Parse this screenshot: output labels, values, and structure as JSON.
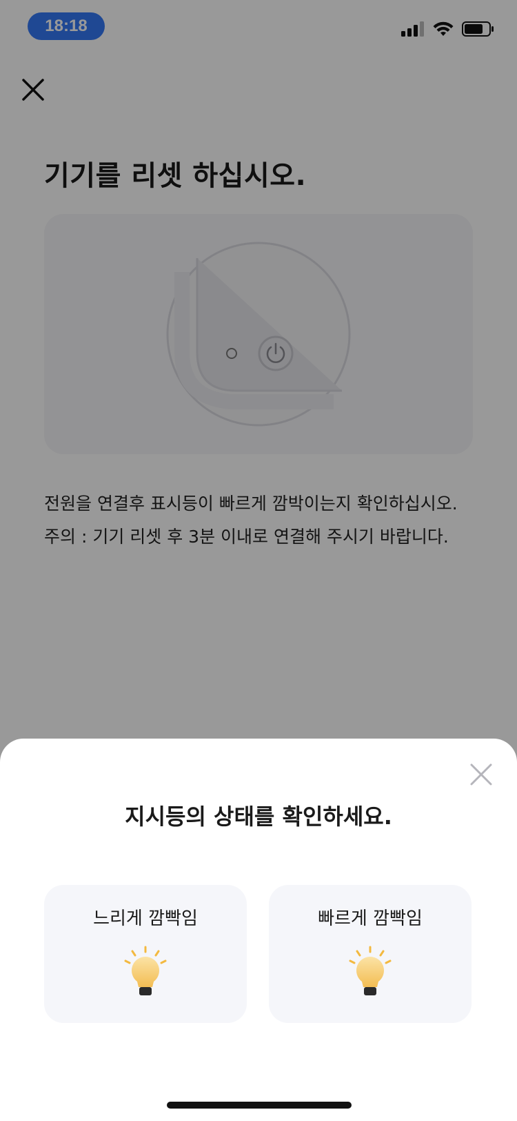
{
  "status_bar": {
    "time": "18:18"
  },
  "main": {
    "title": "기기를 리셋 하십시오.",
    "description_line1": "전원을 연결후 표시등이 빠르게 깜박이는지 확인하십시오.",
    "description_line2": "주의 : 기기 리셋 후 3분 이내로 연결해 주시기 바랍니다."
  },
  "sheet": {
    "title": "지시등의 상태를 확인하세요.",
    "options": [
      {
        "label": "느리게 깜빡임",
        "icon": "lightbulb-icon"
      },
      {
        "label": "빠르게 깜빡임",
        "icon": "lightbulb-icon"
      }
    ]
  },
  "colors": {
    "accent": "#3478f6",
    "bulb": "#f6c45a",
    "overlay": "#000000"
  }
}
